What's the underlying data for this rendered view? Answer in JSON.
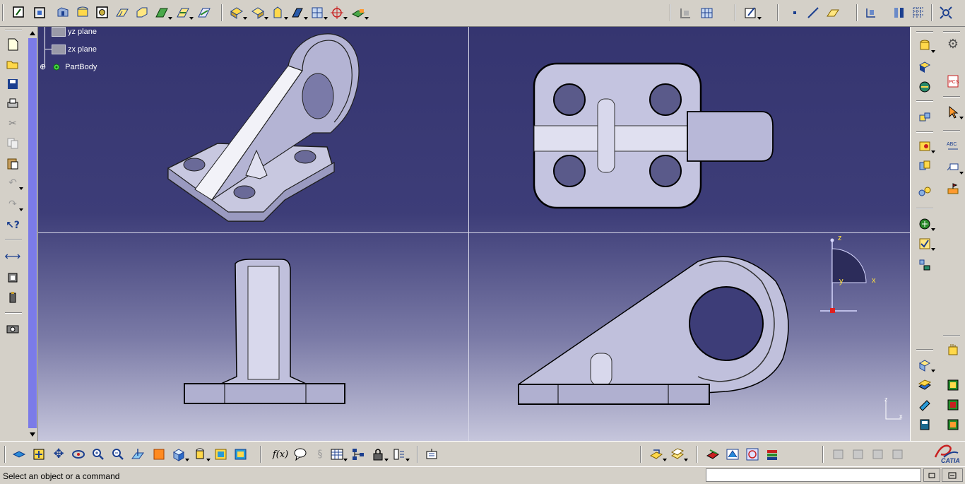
{
  "tree": {
    "items": [
      {
        "label": "yz plane"
      },
      {
        "label": "zx plane"
      },
      {
        "label": "PartBody"
      }
    ]
  },
  "compass": {
    "z": "z",
    "x": "x",
    "y": "y"
  },
  "axis_small": {
    "z": "z",
    "x": "x"
  },
  "status": {
    "message": "Select an object or a command"
  },
  "command_input": {
    "value": ""
  },
  "brand": {
    "name": "CATIA"
  },
  "bottom_toolbar": {
    "formula_label": "f(x)"
  },
  "icons": {
    "top": [
      "sketch-icon",
      "pad-icon",
      "pocket-icon",
      "shaft-icon",
      "groove-icon",
      "hole-icon",
      "rib-icon",
      "slot-icon",
      "stiffener-icon",
      "multi-sections-icon",
      "fillet-icon",
      "chamfer-icon",
      "draft-icon",
      "shell-icon",
      "thickness-icon",
      "thread-icon",
      "remove-face-icon",
      "axis-system-icon",
      "point-icon",
      "line-icon",
      "plane-icon"
    ],
    "left": [
      "new-icon",
      "open-icon",
      "save-icon",
      "print-icon",
      "cut-icon",
      "copy-icon",
      "paste-icon",
      "undo-icon",
      "redo-icon",
      "whats-this-icon",
      "measure-icon",
      "measure-item-icon",
      "inertia-icon",
      "capture-icon"
    ],
    "right": [
      "apply-material-icon",
      "constraint-icon",
      "analysis-icon",
      "catalog-icon",
      "product-icon"
    ]
  }
}
